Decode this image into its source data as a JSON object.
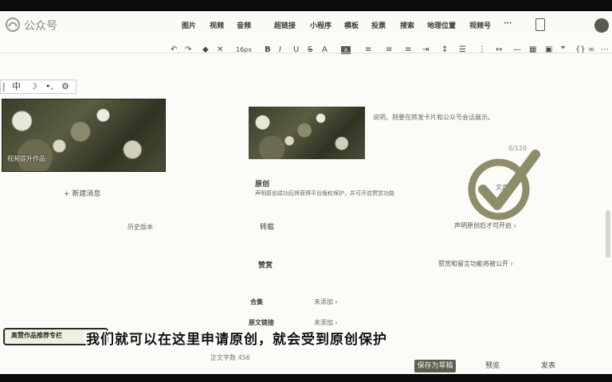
{
  "header": {
    "brand": "公众号",
    "nav": [
      "图片",
      "视频",
      "音频",
      "超链接",
      "小程序",
      "模板",
      "投票",
      "搜索",
      "地理位置",
      "视频号",
      "···"
    ]
  },
  "toolbar": {
    "undo": "↶",
    "redo": "↷",
    "font_size": "16px",
    "bold": "B",
    "italic": "I",
    "underline": "U",
    "strike": "S",
    "font_color": "A"
  },
  "sidetools": [
    "中",
    "☽",
    "•,",
    "⚙"
  ],
  "cover": {
    "caption": "视频提升作品"
  },
  "add_message": "+ 新建消息",
  "history": "历史版本",
  "card_tip": "说明，则要在转发卡片和公众号会话展示。",
  "counter": "0/120",
  "original": {
    "label": "原创",
    "desc": "声明原创成功后将获得平台版权保护，并可开启赞赏功能"
  },
  "watermark_label": "文声明",
  "reprint": {
    "label": "转载",
    "action": "声明原创后才可开启 ›"
  },
  "appreciate": {
    "label": "赞赏",
    "action": "赞赏和留言功能将被公开 ›"
  },
  "collection": {
    "label": "合集",
    "value": "未添加 ›"
  },
  "original_link": {
    "label": "原文链接",
    "value": "未添加 ›"
  },
  "word_count": "正文字数 456",
  "subtitle": "我们就可以在这里申请原创，就会受到原创保护",
  "left_badge": "高赞作品推荐专栏",
  "buttons": {
    "save": "保存为草稿",
    "preview": "预览",
    "publish": "发表"
  },
  "colors": {
    "accent": "#5d5d50",
    "check": "#8d8d6a"
  }
}
